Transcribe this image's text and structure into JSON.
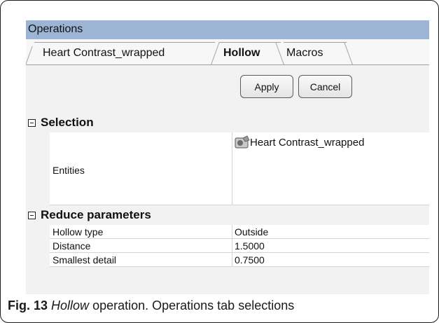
{
  "window": {
    "title": "Operations"
  },
  "tabs": [
    {
      "label": "Heart Contrast_wrapped",
      "active": false
    },
    {
      "label": "Hollow",
      "active": true
    },
    {
      "label": "Macros",
      "active": false
    }
  ],
  "actions": {
    "apply_label": "Apply",
    "cancel_label": "Cancel"
  },
  "sections": {
    "selection": {
      "title": "Selection",
      "entities_label": "Entities",
      "entities_value": "Heart Contrast_wrapped",
      "entities_icon": "mesh-part-icon"
    },
    "reduce": {
      "title": "Reduce parameters",
      "rows": [
        {
          "key": "Hollow type",
          "value": "Outside"
        },
        {
          "key": "Distance",
          "value": "1.5000"
        },
        {
          "key": "Smallest detail",
          "value": "0.7500"
        }
      ]
    }
  },
  "caption": {
    "fig_label": "Fig. 13",
    "italic": "Hollow",
    "rest": " operation. Operations tab selections"
  },
  "colors": {
    "titlebar": "#9cb5d4",
    "panel": "#f2f2f2"
  }
}
